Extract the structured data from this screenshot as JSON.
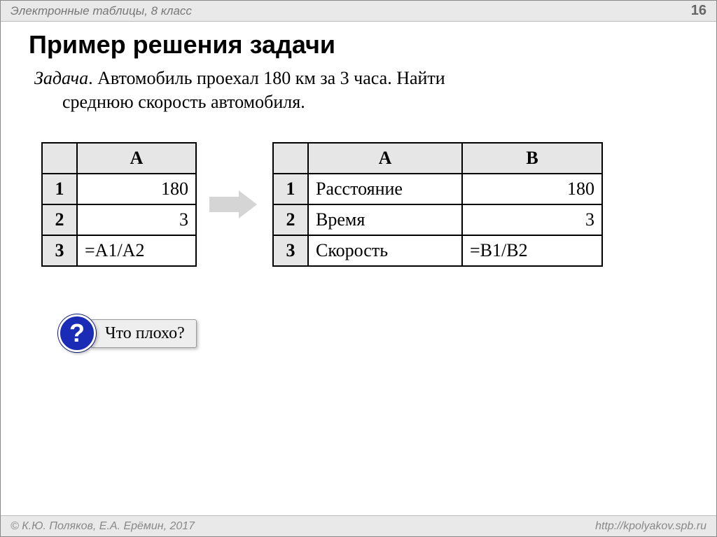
{
  "header": {
    "subject": "Электронные таблицы, 8 класс",
    "page": "16"
  },
  "title": "Пример решения задачи",
  "problem": {
    "lead": "Задача",
    "text_line1": ". Автомобиль проехал 180 км за 3 часа. Найти",
    "text_line2": "среднюю скорость автомобиля."
  },
  "table1": {
    "colA": "A",
    "rows": [
      {
        "num": "1",
        "val": "180",
        "align": "num"
      },
      {
        "num": "2",
        "val": "3",
        "align": "num"
      },
      {
        "num": "3",
        "val": "=A1/A2",
        "align": "formula"
      }
    ]
  },
  "table2": {
    "colA": "A",
    "colB": "B",
    "rows": [
      {
        "num": "1",
        "a": "Расстояние",
        "b": "180",
        "balign": "num"
      },
      {
        "num": "2",
        "a": "Время",
        "b": "3",
        "balign": "num"
      },
      {
        "num": "3",
        "a": "Скорость",
        "b": "=B1/B2",
        "balign": "formula"
      }
    ]
  },
  "callout": {
    "mark": "?",
    "text": "Что плохо?"
  },
  "footer": {
    "left": "© К.Ю. Поляков, Е.А. Ерёмин, 2017",
    "right": "http://kpolyakov.spb.ru"
  }
}
